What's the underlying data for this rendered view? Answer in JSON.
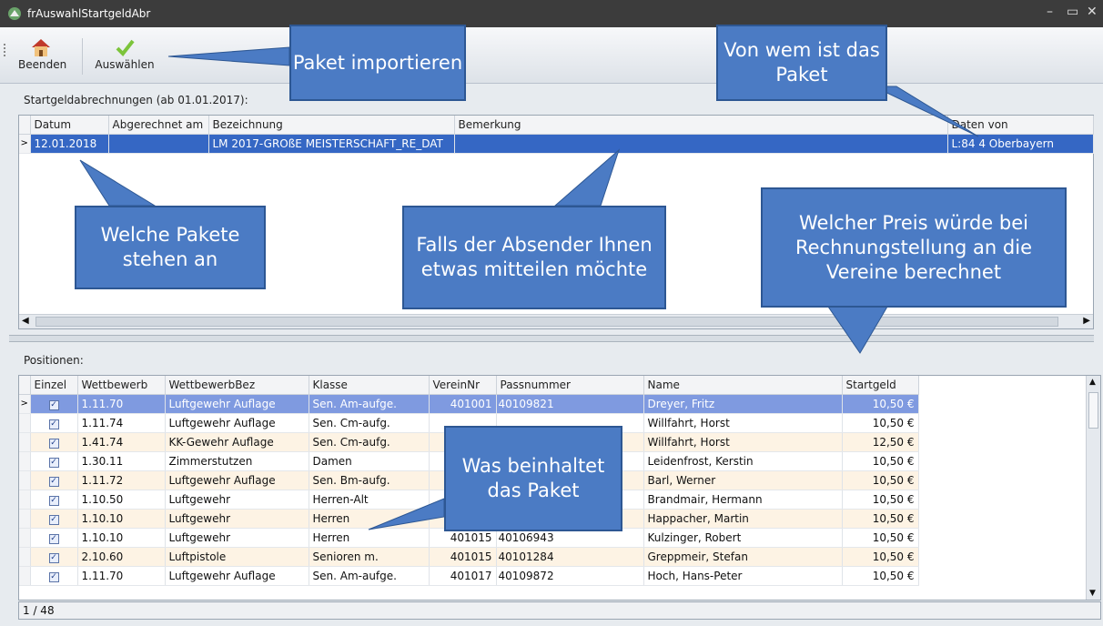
{
  "window": {
    "title": "frAuswahlStartgeldAbr"
  },
  "toolbar": {
    "quit_label": "Beenden",
    "select_label": "Auswählen"
  },
  "top_panel": {
    "label": "Startgeldabrechnungen (ab 01.01.2017):",
    "columns": [
      "Datum",
      "Abgerechnet am",
      "Bezeichnung",
      "Bemerkung",
      "Daten von"
    ],
    "rows": [
      {
        "datum": "12.01.2018",
        "abgerechnet": "",
        "bezeichnung": "LM 2017-GROßE MEISTERSCHAFT_RE_DAT",
        "bemerkung": "",
        "daten_von": "L:84 4 Oberbayern"
      }
    ]
  },
  "bottom_panel": {
    "label": "Positionen:",
    "columns": [
      "Einzel",
      "Wettbewerb",
      "WettbewerbBez",
      "Klasse",
      "VereinNr",
      "Passnummer",
      "Name",
      "Startgeld"
    ],
    "rows": [
      {
        "einzel": true,
        "wettbewerb": "1.11.70",
        "bez": "Luftgewehr Auflage",
        "klasse": "Sen. Am-aufge.",
        "verein": "401001",
        "pass": "40109821",
        "name": "Dreyer, Fritz",
        "startgeld": "10,50 €"
      },
      {
        "einzel": true,
        "wettbewerb": "1.11.74",
        "bez": "Luftgewehr Auflage",
        "klasse": "Sen. Cm-aufg.",
        "verein": "",
        "pass": "",
        "name": "Willfahrt, Horst",
        "startgeld": "10,50 €"
      },
      {
        "einzel": true,
        "wettbewerb": "1.41.74",
        "bez": "KK-Gewehr Auflage",
        "klasse": "Sen. Cm-aufg.",
        "verein": "",
        "pass": "",
        "name": "Willfahrt, Horst",
        "startgeld": "12,50 €"
      },
      {
        "einzel": true,
        "wettbewerb": "1.30.11",
        "bez": "Zimmerstutzen",
        "klasse": "Damen",
        "verein": "",
        "pass": "",
        "name": "Leidenfrost, Kerstin",
        "startgeld": "10,50 €"
      },
      {
        "einzel": true,
        "wettbewerb": "1.11.72",
        "bez": "Luftgewehr Auflage",
        "klasse": "Sen. Bm-aufg.",
        "verein": "",
        "pass": "",
        "name": "Barl, Werner",
        "startgeld": "10,50 €"
      },
      {
        "einzel": true,
        "wettbewerb": "1.10.50",
        "bez": "Luftgewehr",
        "klasse": "Herren-Alt",
        "verein": "",
        "pass": "",
        "name": "Brandmair, Hermann",
        "startgeld": "10,50 €"
      },
      {
        "einzel": true,
        "wettbewerb": "1.10.10",
        "bez": "Luftgewehr",
        "klasse": "Herren",
        "verein": "",
        "pass": "",
        "name": "Happacher, Martin",
        "startgeld": "10,50 €"
      },
      {
        "einzel": true,
        "wettbewerb": "1.10.10",
        "bez": "Luftgewehr",
        "klasse": "Herren",
        "verein": "401015",
        "pass": "40106943",
        "name": "Kulzinger, Robert",
        "startgeld": "10,50 €"
      },
      {
        "einzel": true,
        "wettbewerb": "2.10.60",
        "bez": "Luftpistole",
        "klasse": "Senioren  m.",
        "verein": "401015",
        "pass": "40101284",
        "name": "Greppmeir, Stefan",
        "startgeld": "10,50 €"
      },
      {
        "einzel": true,
        "wettbewerb": "1.11.70",
        "bez": "Luftgewehr Auflage",
        "klasse": "Sen. Am-aufge.",
        "verein": "401017",
        "pass": "40109872",
        "name": "Hoch, Hans-Peter",
        "startgeld": "10,50 €"
      }
    ],
    "pager": "1 / 48"
  },
  "callouts": {
    "paket": "Paket importieren",
    "von_wem": "Von wem ist das Paket",
    "welche": "Welche Pakete stehen an",
    "absender": "Falls der Absender Ihnen etwas mitteilen möchte",
    "preis": "Welcher Preis würde bei Rechnungstellung  an die Vereine berechnet",
    "inhalt": "Was beinhaltet das Paket"
  },
  "colors": {
    "callout": "#4b7bc4",
    "selection": "#3567c4",
    "alt_row": "#fdf3e4",
    "titlebar": "#3c3c3c"
  }
}
